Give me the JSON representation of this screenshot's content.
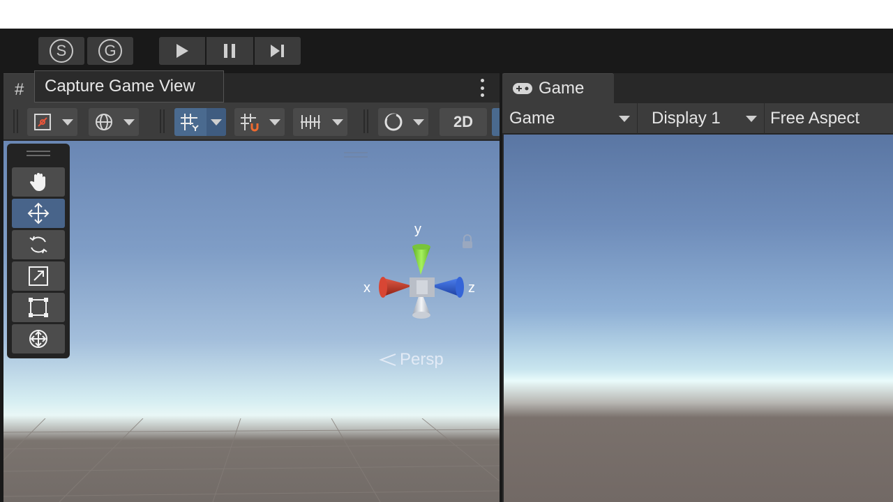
{
  "toolbar": {
    "sg_buttons": [
      {
        "label": "S",
        "icon": "s-circle-icon"
      },
      {
        "label": "G",
        "icon": "g-circle-icon"
      }
    ],
    "play_controls": [
      "play-icon",
      "pause-icon",
      "step-icon"
    ]
  },
  "scene": {
    "tab_icon": "#",
    "tooltip": "Capture Game View",
    "toggle_2d": "2D",
    "gizmo": {
      "x": "x",
      "y": "y",
      "z": "z"
    },
    "projection": "Persp"
  },
  "game": {
    "tab_label": "Game",
    "view_mode": "Game",
    "display": "Display 1",
    "aspect": "Free Aspect"
  },
  "colors": {
    "accent_active": "#4a6a8f",
    "axis_x": "#d9412e",
    "axis_y": "#8be03c",
    "axis_z": "#3a6fe0"
  }
}
